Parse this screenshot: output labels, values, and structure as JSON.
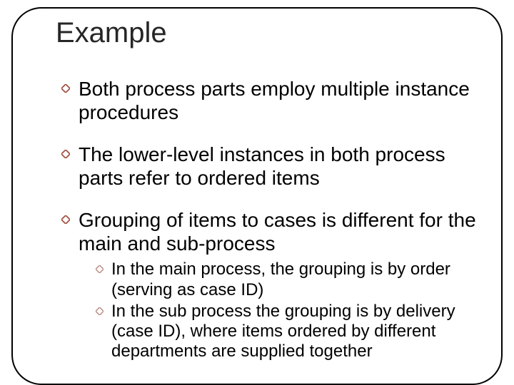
{
  "title": "Example",
  "bullets": [
    {
      "text": "Both process parts employ multiple instance procedures"
    },
    {
      "text": "The lower-level instances in both process parts refer to ordered items"
    },
    {
      "text": "Grouping of items to cases is different for the main and sub-process",
      "sub": [
        {
          "text": "In the main process, the grouping is by order (serving as case ID)"
        },
        {
          "text": "In the sub process the grouping is by delivery (case ID), where items ordered by different departments are supplied together"
        }
      ]
    }
  ]
}
